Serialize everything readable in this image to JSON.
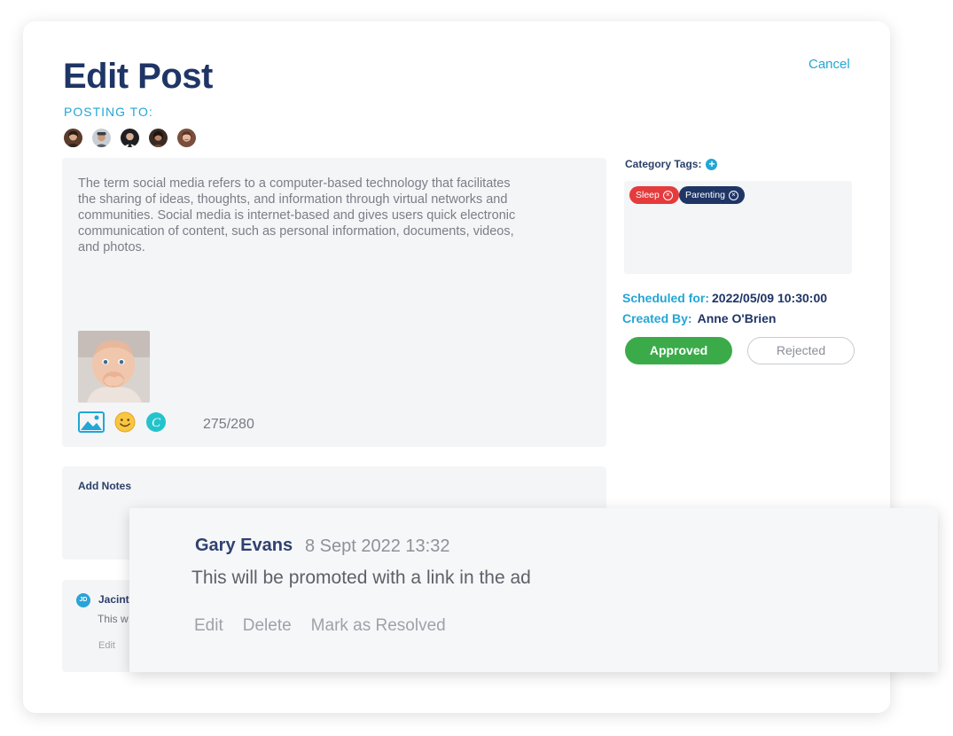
{
  "page": {
    "title": "Edit Post",
    "cancel_label": "Cancel",
    "posting_to_label": "POSTING TO:"
  },
  "avatars": [
    {
      "icon": "avatar-woman-icon",
      "color": "#5b3b2c"
    },
    {
      "icon": "avatar-man-cap-icon",
      "color": "#8a9098"
    },
    {
      "icon": "avatar-man-suit-icon",
      "color": "#1f1f22"
    },
    {
      "icon": "avatar-woman-dark-icon",
      "color": "#3a2a24"
    },
    {
      "icon": "avatar-woman-smile-icon",
      "color": "#7a4e3d"
    }
  ],
  "composer": {
    "post_text": "The term social media refers to a computer-based technology that facilitates the sharing of ideas, thoughts, and information through virtual networks and communities. Social media is internet-based and gives users quick electronic communication of content, such as personal information, documents, videos, and photos.",
    "image_icon": "baby-photo-icon",
    "tools": [
      "image-icon",
      "emoji-icon",
      "canva-icon"
    ],
    "char_count": "275/280"
  },
  "notes": {
    "label": "Add Notes"
  },
  "existing_comment": {
    "initials": "JD",
    "name": "Jacint",
    "text": "This w",
    "edit_label": "Edit"
  },
  "sidebar": {
    "category_tags_label": "Category Tags:",
    "tags": [
      {
        "label": "Sleep",
        "color": "#e53b3d"
      },
      {
        "label": "Parenting",
        "color": "#1f3566"
      }
    ],
    "scheduled_label": "Scheduled for:",
    "scheduled_value": "2022/05/09 10:30:00",
    "created_label": "Created By:",
    "created_value": "Anne O'Brien",
    "approved_label": "Approved",
    "rejected_label": "Rejected"
  },
  "popup_comment": {
    "author": "Gary Evans",
    "date": "8 Sept 2022 13:32",
    "text": "This will be promoted with a link in the ad",
    "actions": [
      "Edit",
      "Delete",
      "Mark as Resolved"
    ]
  },
  "colors": {
    "brand_navy": "#1f3566",
    "accent_blue": "#22a6d6",
    "approved_green": "#3bab4a",
    "tag_red": "#e53b3d"
  }
}
